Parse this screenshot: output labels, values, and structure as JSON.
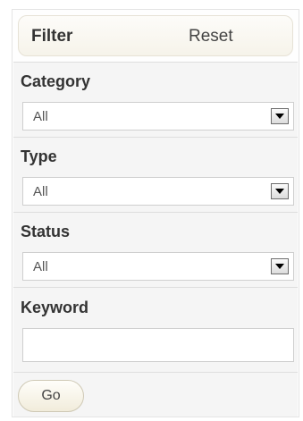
{
  "header": {
    "title": "Filter",
    "reset_label": "Reset"
  },
  "filters": {
    "category": {
      "label": "Category",
      "selected": "All"
    },
    "type": {
      "label": "Type",
      "selected": "All"
    },
    "status": {
      "label": "Status",
      "selected": "All"
    },
    "keyword": {
      "label": "Keyword",
      "value": "",
      "placeholder": ""
    }
  },
  "actions": {
    "go_label": "Go"
  },
  "icons": {
    "dropdown": "chevron-down-icon"
  },
  "colors": {
    "section_background": "#f5f5f5",
    "header_background": "#f6f3ea",
    "text": "#333333"
  }
}
